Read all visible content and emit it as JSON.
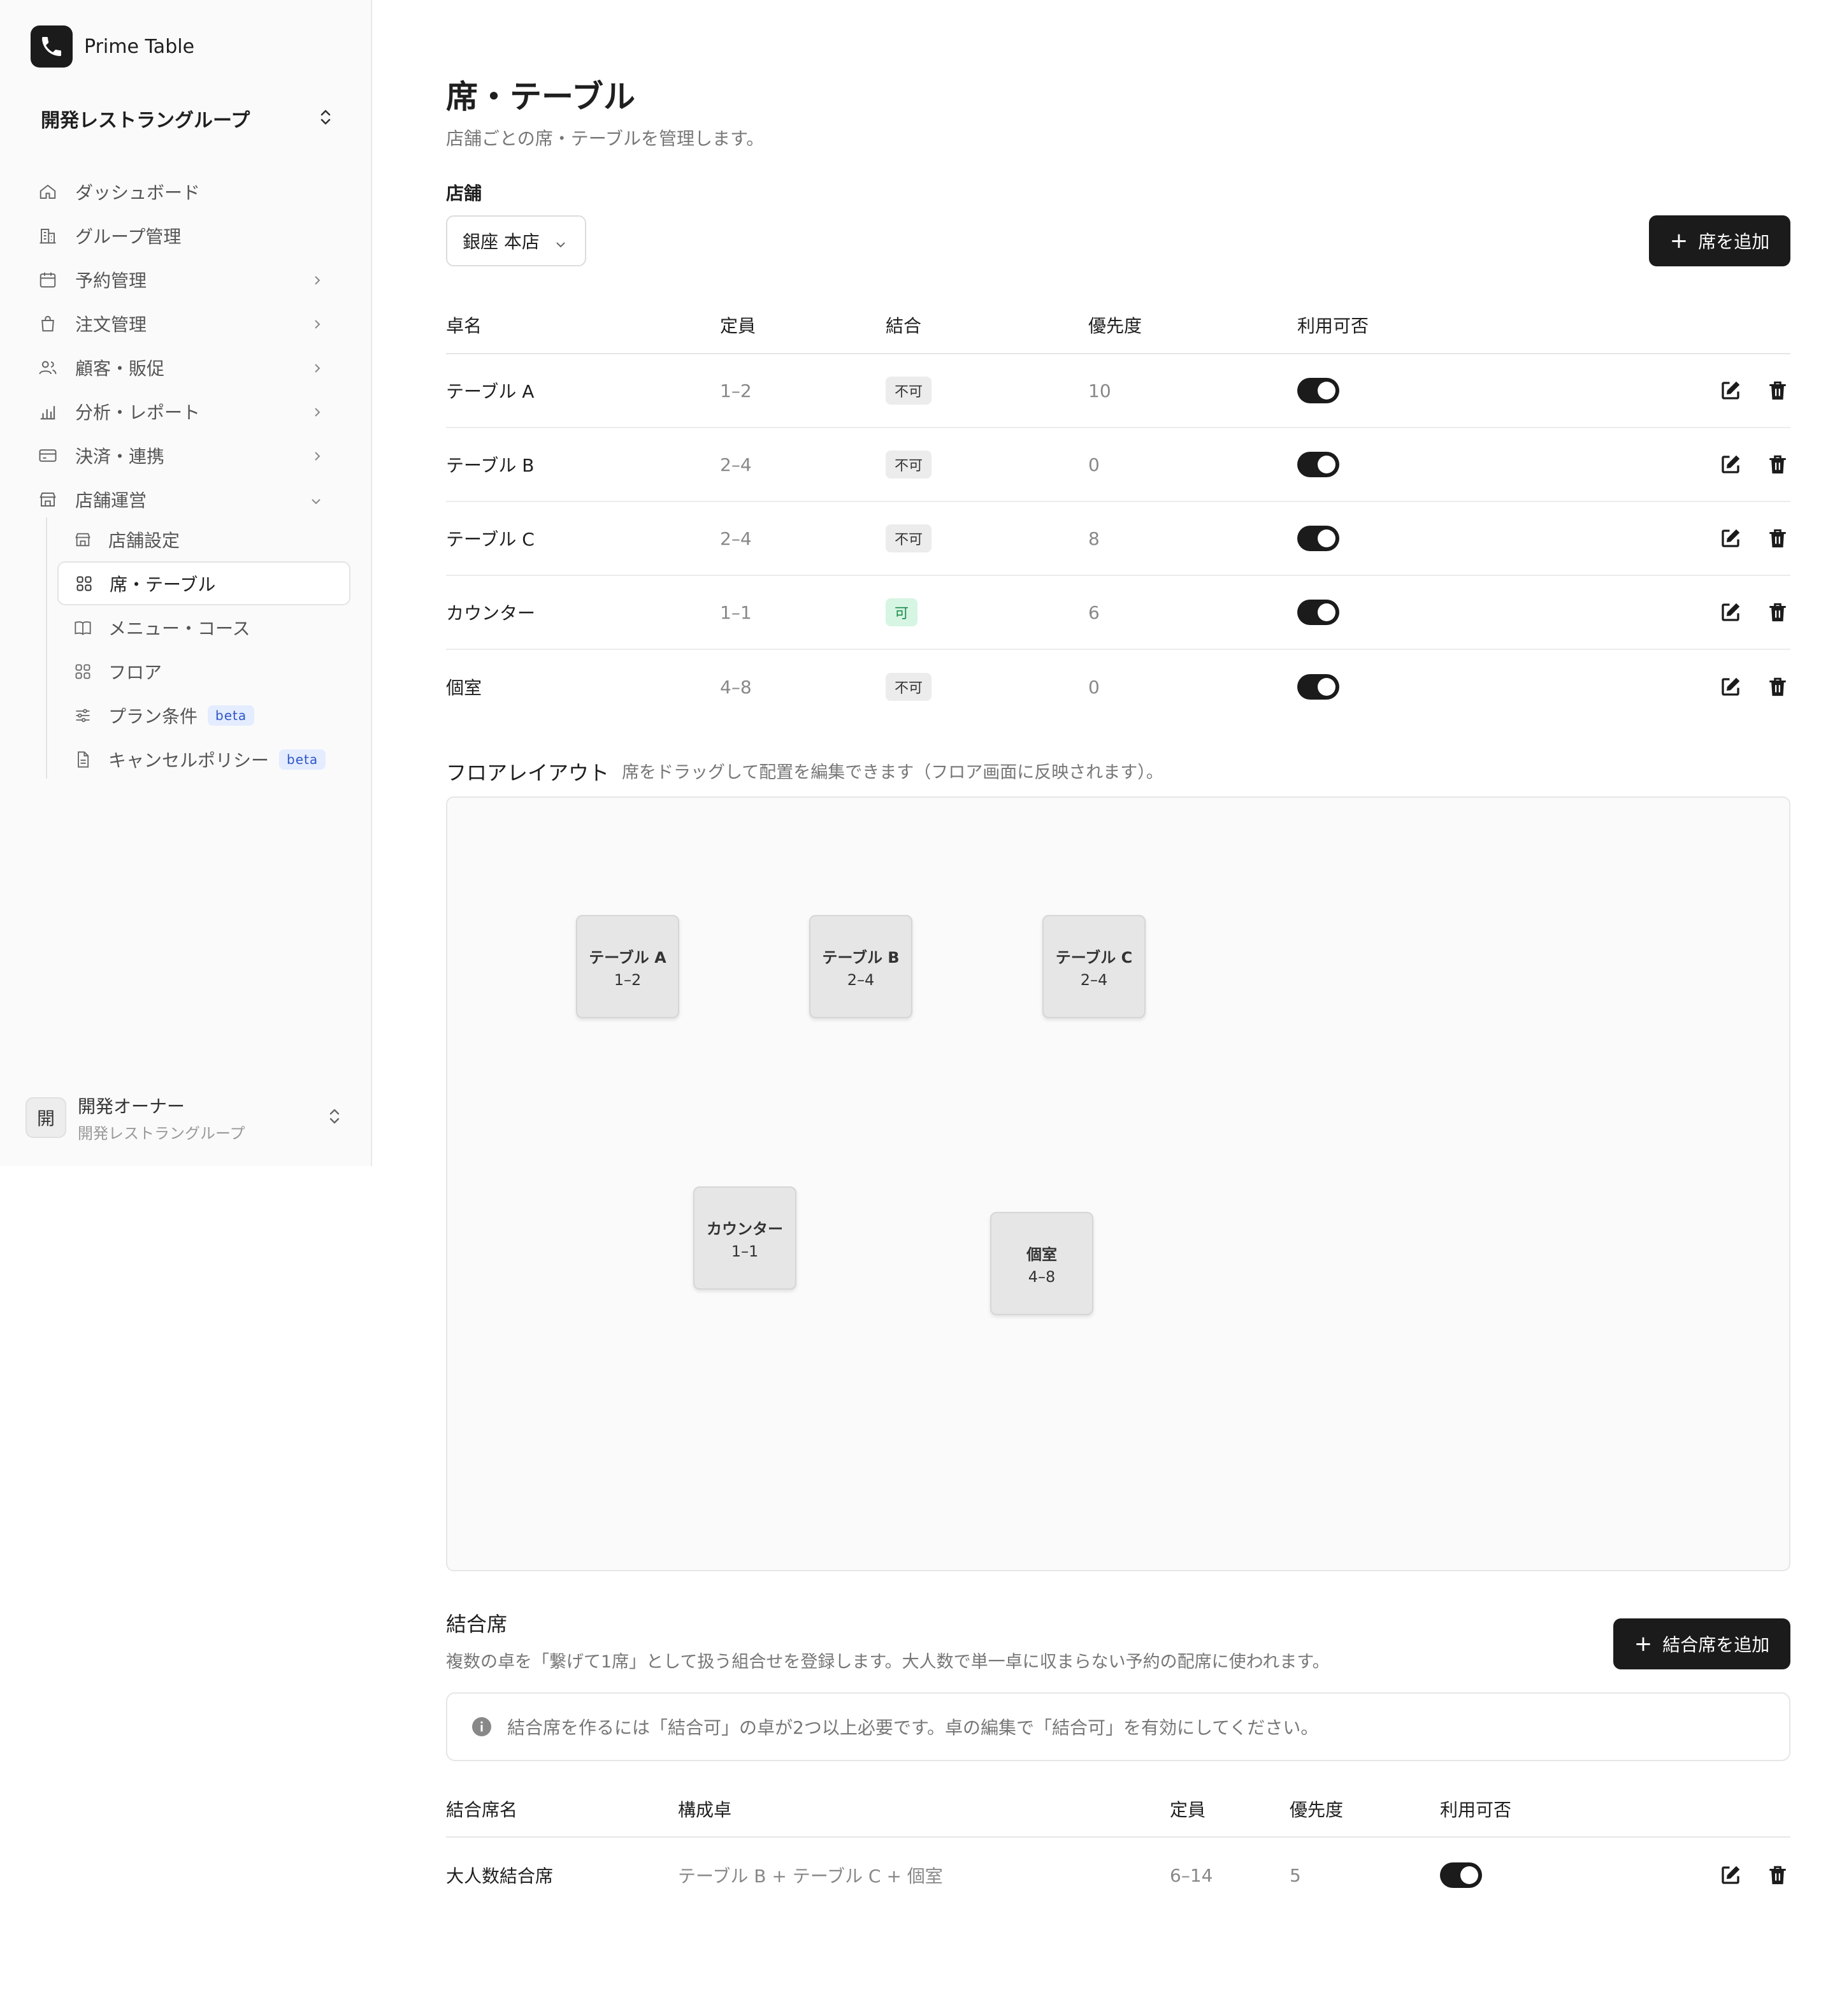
{
  "app": {
    "name": "Prime Table"
  },
  "org": {
    "name": "開発レストラングループ"
  },
  "nav": [
    {
      "label": "ダッシュボード",
      "icon": "home-icon"
    },
    {
      "label": "グループ管理",
      "icon": "building-icon"
    },
    {
      "label": "予約管理",
      "icon": "calendar-icon"
    },
    {
      "label": "注文管理",
      "icon": "bag-icon"
    },
    {
      "label": "顧客・販促",
      "icon": "users-icon"
    },
    {
      "label": "分析・レポート",
      "icon": "chart-icon"
    },
    {
      "label": "決済・連携",
      "icon": "card-icon"
    },
    {
      "label": "店舗運営",
      "icon": "store-icon"
    }
  ],
  "subnav": [
    {
      "label": "店舗設定"
    },
    {
      "label": "席・テーブル"
    },
    {
      "label": "メニュー・コース"
    },
    {
      "label": "フロア"
    },
    {
      "label": "プラン条件",
      "badge": "beta"
    },
    {
      "label": "キャンセルポリシー",
      "badge": "beta"
    }
  ],
  "user": {
    "name": "開発オーナー",
    "org": "開発レストラングループ",
    "initial": "開"
  },
  "page": {
    "title": "席・テーブル",
    "subtitle": "店舗ごとの席・テーブルを管理します。",
    "store_label": "店舗",
    "store_value": "銀座 本店",
    "add_seat_label": "席を追加"
  },
  "tables": {
    "headers": {
      "name": "卓名",
      "capacity": "定員",
      "combine": "結合",
      "priority": "優先度",
      "available": "利用可否"
    },
    "rows": [
      {
        "name": "テーブル A",
        "capacity": "1–2",
        "combine": "不可",
        "priority": "10",
        "available": true
      },
      {
        "name": "テーブル B",
        "capacity": "2–4",
        "combine": "不可",
        "priority": "0",
        "available": true
      },
      {
        "name": "テーブル C",
        "capacity": "2–4",
        "combine": "不可",
        "priority": "8",
        "available": true
      },
      {
        "name": "カウンター",
        "capacity": "1–1",
        "combine": "可",
        "priority": "6",
        "available": true
      },
      {
        "name": "個室",
        "capacity": "4–8",
        "combine": "不可",
        "priority": "0",
        "available": true
      }
    ]
  },
  "floor": {
    "title": "フロアレイアウト",
    "hint": "席をドラッグして配置を編集できます（フロア画面に反映されます）。",
    "tables": [
      {
        "name": "テーブル A",
        "capacity": "1–2"
      },
      {
        "name": "テーブル B",
        "capacity": "2–4"
      },
      {
        "name": "テーブル C",
        "capacity": "2–4"
      },
      {
        "name": "カウンター",
        "capacity": "1–1"
      },
      {
        "name": "個室",
        "capacity": "4–8"
      }
    ]
  },
  "combined": {
    "title": "結合席",
    "description": "複数の卓を「繋げて1席」として扱う組合せを登録します。大人数で単一卓に収まらない予約の配席に使われます。",
    "add_label": "結合席を追加",
    "info": "結合席を作るには「結合可」の卓が2つ以上必要です。卓の編集で「結合可」を有効にしてください。",
    "headers": {
      "name": "結合席名",
      "members": "構成卓",
      "capacity": "定員",
      "priority": "優先度",
      "available": "利用可否"
    },
    "rows": [
      {
        "name": "大人数結合席",
        "members": "テーブル B + テーブル C + 個室",
        "capacity": "6–14",
        "priority": "5",
        "available": true
      }
    ]
  }
}
